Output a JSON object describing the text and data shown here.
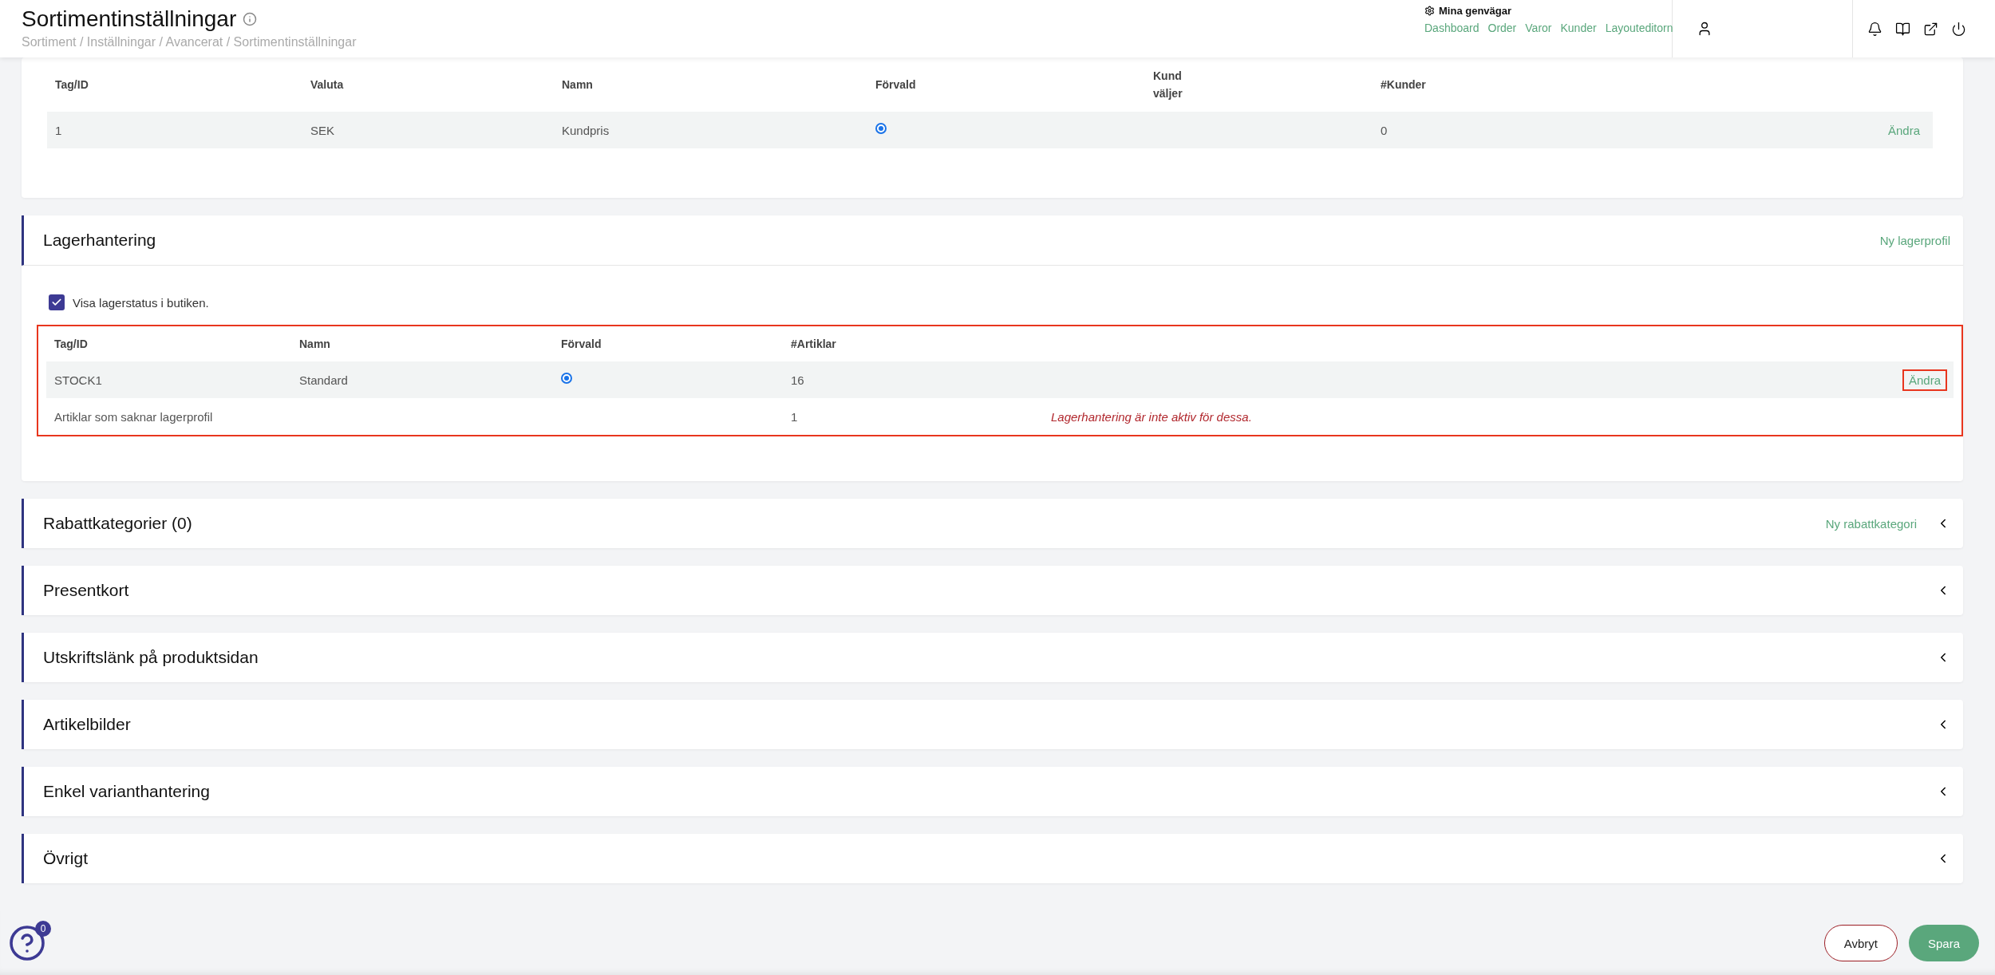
{
  "header": {
    "title": "Sortimentinställningar",
    "breadcrumb": "Sortiment / Inställningar / Avancerat / Sortimentinställningar",
    "shortcuts": {
      "title": "Mina genvägar",
      "links": [
        "Dashboard",
        "Order",
        "Varor",
        "Kunder",
        "Layouteditorn"
      ]
    }
  },
  "price_table": {
    "columns": [
      "Tag/ID",
      "Valuta",
      "Namn",
      "Förvald",
      "Kund väljer",
      "#Kunder"
    ],
    "rows": [
      {
        "tag": "1",
        "currency": "SEK",
        "name": "Kundpris",
        "default": true,
        "customers": "0",
        "action": "Ändra"
      }
    ]
  },
  "stock": {
    "title": "Lagerhantering",
    "action": "Ny lagerprofil",
    "checkbox": {
      "label": "Visa lagerstatus i butiken.",
      "checked": true
    },
    "highlighted": true,
    "columns": [
      "Tag/ID",
      "Namn",
      "Förvald",
      "#Artiklar"
    ],
    "rows": [
      {
        "tag": "STOCK1",
        "name": "Standard",
        "default": true,
        "count": "16",
        "action": "Ändra",
        "action_highlighted": true
      }
    ],
    "missing": {
      "label": "Artiklar som saknar lagerprofil",
      "count": "1",
      "note": "Lagerhantering är inte aktiv för dessa."
    }
  },
  "sections": [
    {
      "title": "Rabattkategorier (0)",
      "action": "Ny rabattkategori",
      "expanded": false
    },
    {
      "title": "Presentkort",
      "expanded": false
    },
    {
      "title": "Utskriftslänk på produktsidan",
      "expanded": false
    },
    {
      "title": "Artikelbilder",
      "expanded": false
    },
    {
      "title": "Enkel varianthantering",
      "expanded": false
    },
    {
      "title": "Övrigt",
      "expanded": false
    }
  ],
  "help": {
    "badge": "0"
  },
  "buttons": [
    "Avbryt",
    "Spara"
  ]
}
